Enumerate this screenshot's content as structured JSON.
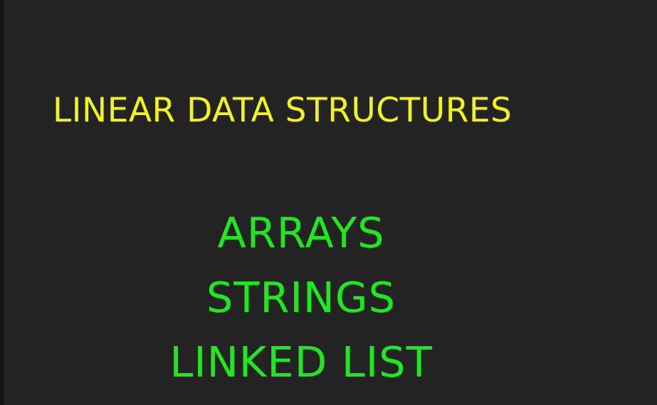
{
  "slide": {
    "title": "LINEAR DATA STRUCTURES",
    "items": [
      "ARRAYS",
      "STRINGS",
      "LINKED LIST"
    ]
  },
  "colors": {
    "background": "#232323",
    "title": "#f3f31a",
    "items": "#1ee81e"
  }
}
